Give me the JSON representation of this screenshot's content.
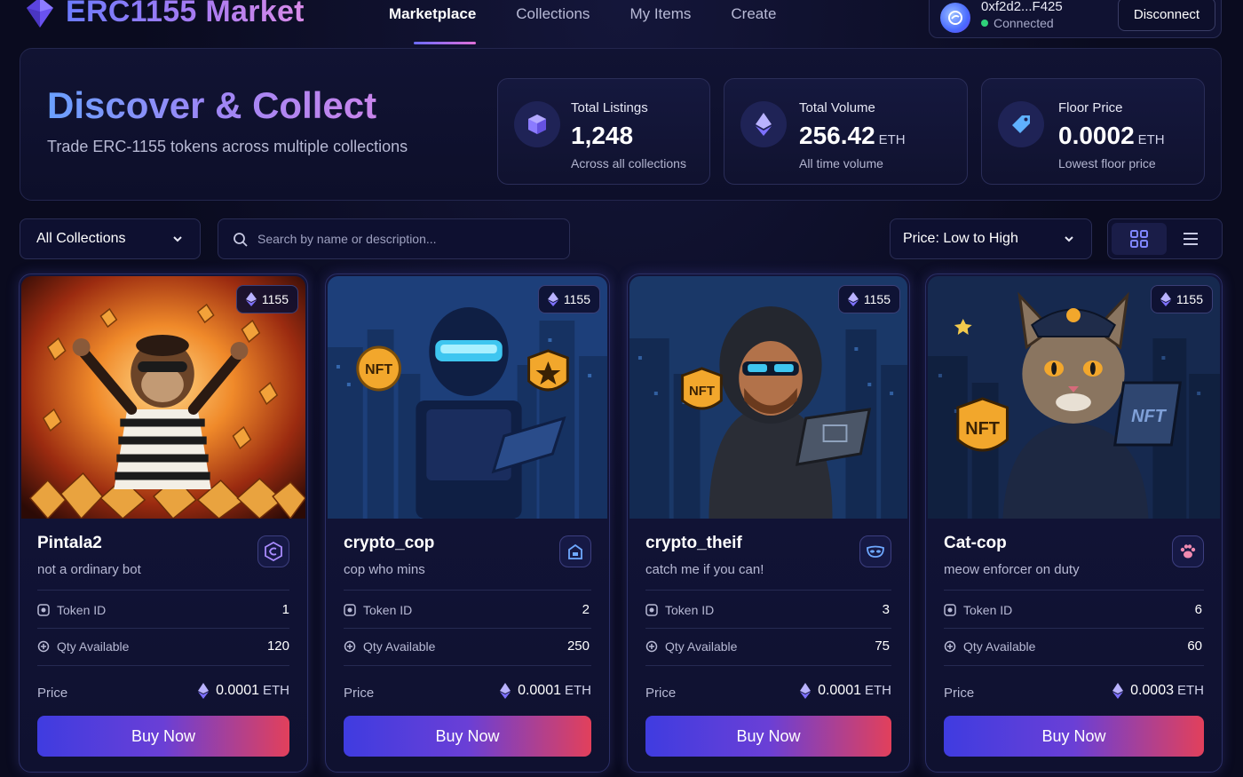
{
  "app": {
    "title": "ERC1155 Market",
    "logo_icon": "ethereum-gem-icon"
  },
  "nav": {
    "links": [
      {
        "label": "Marketplace",
        "active": true
      },
      {
        "label": "Collections",
        "active": false
      },
      {
        "label": "My Items",
        "active": false
      },
      {
        "label": "Create",
        "active": false
      }
    ]
  },
  "wallet": {
    "address": "0xf2d2...F425",
    "status": "Connected",
    "status_color": "#2fd17a",
    "disconnect_label": "Disconnect"
  },
  "hero": {
    "title": "Discover & Collect",
    "subtitle": "Trade ERC-1155 tokens across multiple collections"
  },
  "stats": [
    {
      "label": "Total Listings",
      "value": "1,248",
      "unit": "",
      "foot": "Across all collections",
      "icon": "cube-icon"
    },
    {
      "label": "Total Volume",
      "value": "256.42",
      "unit": "ETH",
      "foot": "All time volume",
      "icon": "ethereum-icon"
    },
    {
      "label": "Floor Price",
      "value": "0.0002",
      "unit": "ETH",
      "foot": "Lowest floor price",
      "icon": "price-tag-icon"
    }
  ],
  "filters": {
    "collection": "All Collections",
    "search_placeholder": "Search by name or description...",
    "sort": "Price: Low to High",
    "view_mode": "grid"
  },
  "cards": [
    {
      "name": "Pintala2",
      "description": "not a ordinary bot",
      "badge": "1155",
      "token_label": "Token ID",
      "token_id": "1",
      "qty_label": "Qty Available",
      "qty": "120",
      "price_label": "Price",
      "price": "0.0001",
      "unit": "ETH",
      "buy_label": "Buy Now",
      "collection_icon": "hexagon-logo-icon",
      "art": "monkey-prisoner-with-gems"
    },
    {
      "name": "crypto_cop",
      "description": "cop who mins",
      "badge": "1155",
      "token_label": "Token ID",
      "token_id": "2",
      "qty_label": "Qty Available",
      "qty": "250",
      "price_label": "Price",
      "price": "0.0001",
      "unit": "ETH",
      "buy_label": "Buy Now",
      "collection_icon": "building-icon",
      "art": "armored-cop-with-laptop"
    },
    {
      "name": "crypto_theif",
      "description": "catch me if you can!",
      "badge": "1155",
      "token_label": "Token ID",
      "token_id": "3",
      "qty_label": "Qty Available",
      "qty": "75",
      "price_label": "Price",
      "price": "0.0001",
      "unit": "ETH",
      "buy_label": "Buy Now",
      "collection_icon": "mask-icon",
      "art": "hooded-thief-with-laptop"
    },
    {
      "name": "Cat-cop",
      "description": "meow enforcer on duty",
      "badge": "1155",
      "token_label": "Token ID",
      "token_id": "6",
      "qty_label": "Qty Available",
      "qty": "60",
      "price_label": "Price",
      "price": "0.0003",
      "unit": "ETH",
      "buy_label": "Buy Now",
      "collection_icon": "paw-icon",
      "art": "cat-police-officer"
    }
  ],
  "colors": {
    "accent": "#6c6cff",
    "accent_pink": "#e06fd6",
    "buy_gradient_start": "#3f3ce0",
    "buy_gradient_end": "#e2405b",
    "background": "#0a0b1f"
  }
}
